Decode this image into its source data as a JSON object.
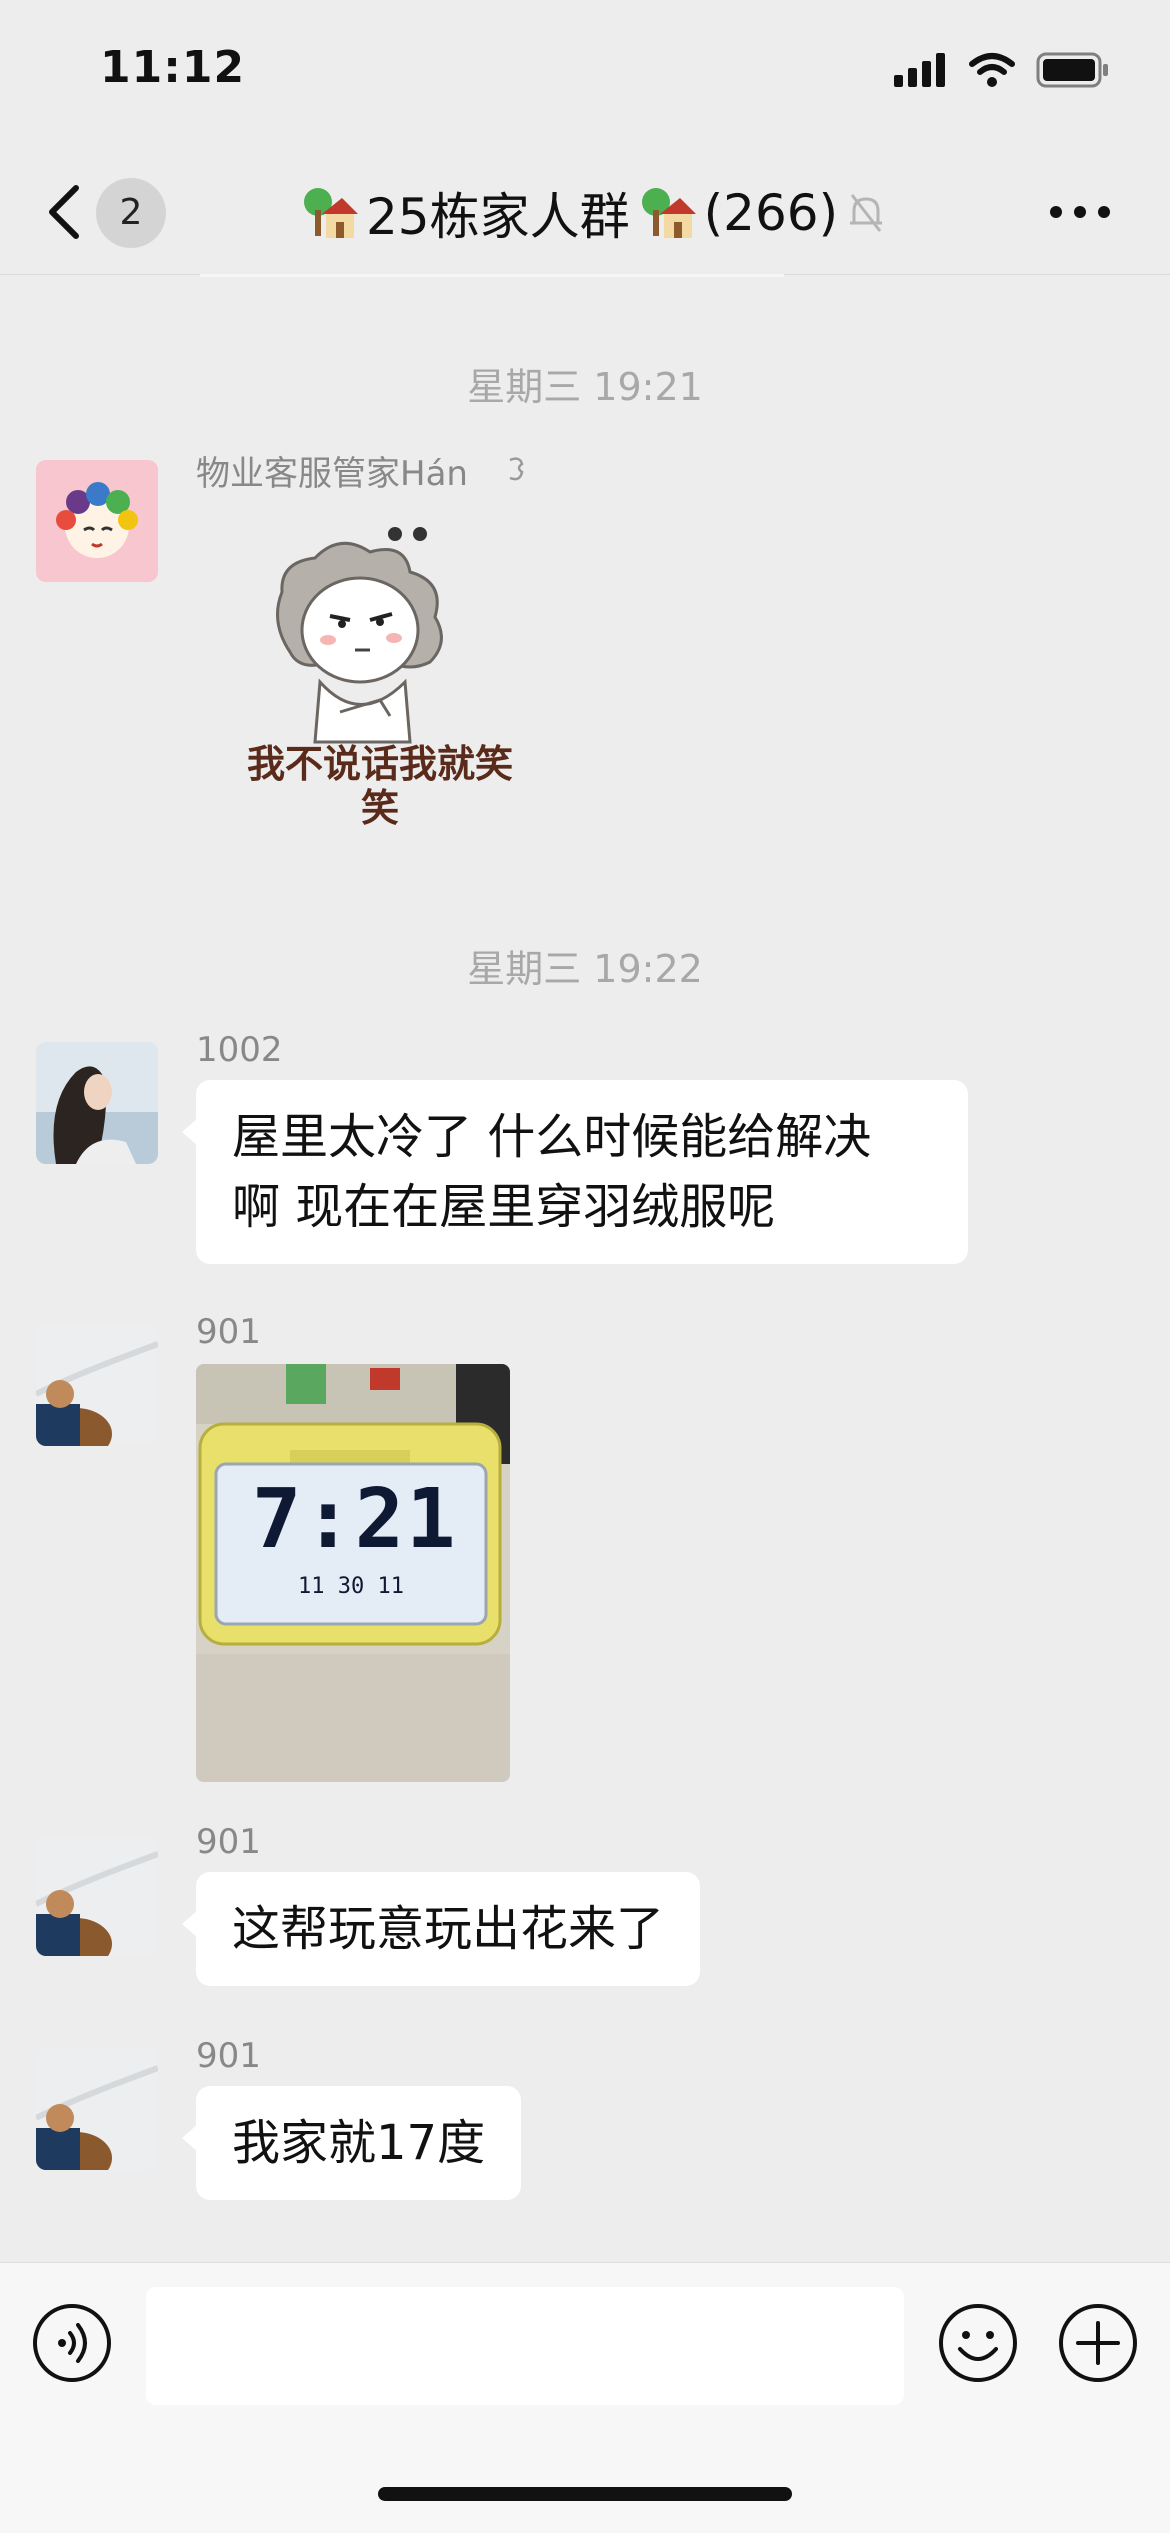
{
  "status_bar": {
    "time": "11:12"
  },
  "nav": {
    "back_count": "2",
    "title": "25栋家人群",
    "member_count": "(266)"
  },
  "messages": [
    {
      "type": "timestamp",
      "text": "星期三 19:21"
    },
    {
      "type": "sticker",
      "sender": "物业客服管家Hán",
      "sticker_text_line1": "我不说话我就笑",
      "sticker_text_line2": "笑"
    },
    {
      "type": "timestamp",
      "text": "星期三 19:22"
    },
    {
      "type": "text",
      "sender": "1002",
      "line1": "屋里太冷了  什么时候能给解决",
      "line2": "啊   现在在屋里穿羽绒服呢"
    },
    {
      "type": "image",
      "sender": "901",
      "image_text": "7:21",
      "image_small": "11 30 11"
    },
    {
      "type": "text",
      "sender": "901",
      "line1": "这帮玩意玩出花来了"
    },
    {
      "type": "text",
      "sender": "901",
      "line1": "我家就17度"
    }
  ],
  "colors": {
    "background": "#ededed",
    "bubble": "#ffffff",
    "timestamp": "#a8a8a8",
    "clock_body": "#e8e06a"
  },
  "icons": [
    "back-chevron-icon",
    "house-tree-icon",
    "mute-bell-icon",
    "more-icon",
    "voice-icon",
    "emoji-icon",
    "plus-icon",
    "signal-icon",
    "wifi-icon",
    "battery-icon"
  ]
}
